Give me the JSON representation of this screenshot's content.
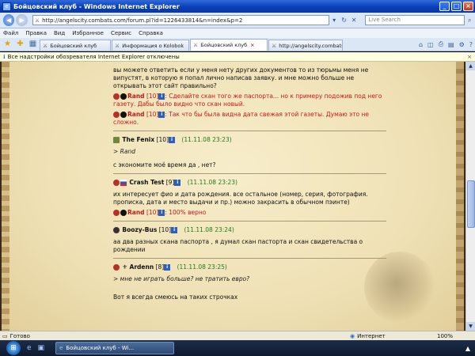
{
  "window": {
    "title": "Бойцовский клуб - Windows Internet Explorer"
  },
  "address": {
    "url": "http://angelscity.combats.com/forum.pl?id=1226433814&n=index&p=2",
    "search_placeholder": "Live Search"
  },
  "menu": [
    "Файл",
    "Правка",
    "Вид",
    "Избранное",
    "Сервис",
    "Справка"
  ],
  "tabs": [
    {
      "label": "Бойцовский клуб"
    },
    {
      "label": "Информация о Kolobok"
    },
    {
      "label": "Бойцовский клуб"
    },
    {
      "label": "http://angelscity.combats...."
    }
  ],
  "infobar": {
    "text": "Все надстройки обозревателя Internet Explorer отключены"
  },
  "posts": {
    "top_text": "вы можете ответить если у меня нету других документов то из тюрьмы меня не випустят, в которую я попал лично написав заявку. и мне можно больше не открывать этот сайт правильно?",
    "top_reply1": {
      "name": "Rand",
      "level": "[10]",
      "text": ": Сделайте скан того же паспорта... но к примеру подожив под него газету. Дабы было видно что скан новый."
    },
    "top_reply2": {
      "name": "Rand",
      "level": "[10]",
      "text": ": Так что бы была видна дата свежая этой газеты. Думаю это не сложно."
    },
    "p1": {
      "user": "The Fenix",
      "level": "[10]",
      "date": "(11.11.08 23:23)",
      "quote": "> Rand",
      "text": "с экономите моё время да , нет?"
    },
    "p2": {
      "user": "Crash Test",
      "level": "[9]",
      "date": "(11.11.08 23:23)",
      "text": "их интересует фио и дата рождения. все остальное (номер, серия, фотография. прописка, дата и место выдачи и пр.) можно закрасить в обычном пэинте)",
      "reply": {
        "name": "Rand",
        "level": "[10]",
        "text": ": 100% верно"
      }
    },
    "p3": {
      "user": "Boozy-Bus",
      "level": "[10]",
      "date": "(11.11.08 23:24)",
      "text": "аа два разных скана паспорта , я думал скан пасторта и скан свидетельства о рождении"
    },
    "p4": {
      "user": "Ardenn",
      "level": "[8]",
      "date": "(11.11.08 23:25)",
      "quote": "> мне не играть больше? не тратить евро?",
      "text": "Вот я всегда смеюсь на таких строчках"
    }
  },
  "status": {
    "done": "Готово",
    "zone": "Интернет",
    "zoom": "100%"
  },
  "taskbar": {
    "task_label": "Бойцовский клуб - Wi..."
  }
}
